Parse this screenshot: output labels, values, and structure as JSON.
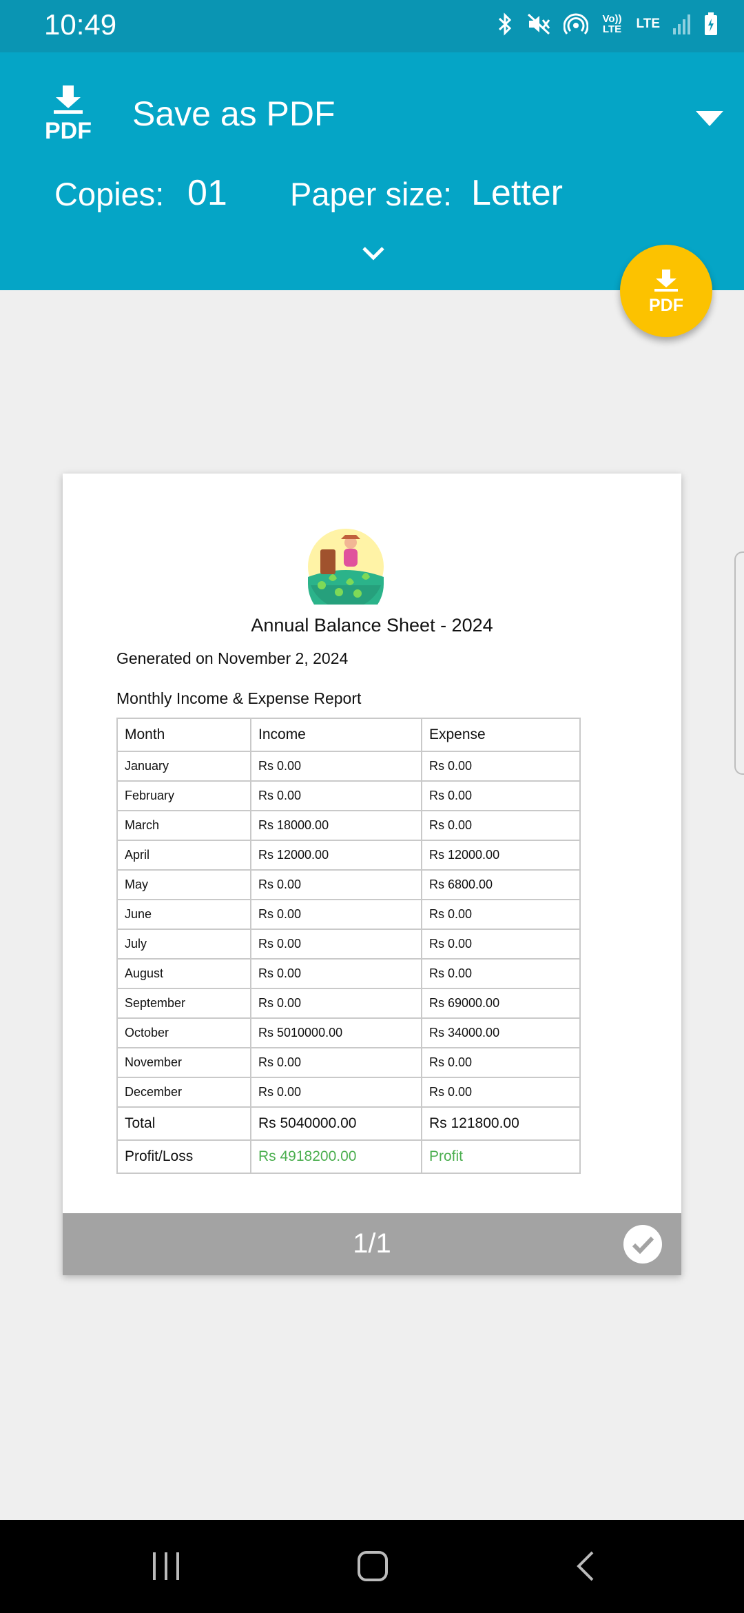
{
  "status": {
    "time": "10:49",
    "lte_label": "LTE",
    "volte_label": "Vo)) LTE"
  },
  "header": {
    "pdf_icon_text": "PDF",
    "title": "Save as PDF",
    "copies_label": "Copies:",
    "copies_value": "01",
    "paper_label": "Paper size:",
    "paper_value": "Letter"
  },
  "fab": {
    "label": "PDF"
  },
  "document": {
    "title": "Annual Balance Sheet - 2024",
    "generated": "Generated on November 2, 2024",
    "subtitle": "Monthly Income & Expense Report",
    "columns": [
      "Month",
      "Income",
      "Expense"
    ],
    "rows": [
      {
        "month": "January",
        "income": "Rs 0.00",
        "expense": "Rs 0.00"
      },
      {
        "month": "February",
        "income": "Rs 0.00",
        "expense": "Rs 0.00"
      },
      {
        "month": "March",
        "income": "Rs 18000.00",
        "expense": "Rs 0.00"
      },
      {
        "month": "April",
        "income": "Rs 12000.00",
        "expense": "Rs 12000.00"
      },
      {
        "month": "May",
        "income": "Rs 0.00",
        "expense": "Rs 6800.00"
      },
      {
        "month": "June",
        "income": "Rs 0.00",
        "expense": "Rs 0.00"
      },
      {
        "month": "July",
        "income": "Rs 0.00",
        "expense": "Rs 0.00"
      },
      {
        "month": "August",
        "income": "Rs 0.00",
        "expense": "Rs 0.00"
      },
      {
        "month": "September",
        "income": "Rs 0.00",
        "expense": "Rs 69000.00"
      },
      {
        "month": "October",
        "income": "Rs 5010000.00",
        "expense": "Rs 34000.00"
      },
      {
        "month": "November",
        "income": "Rs 0.00",
        "expense": "Rs 0.00"
      },
      {
        "month": "December",
        "income": "Rs 0.00",
        "expense": "Rs 0.00"
      }
    ],
    "total": {
      "label": "Total",
      "income": "Rs 5040000.00",
      "expense": "Rs 121800.00"
    },
    "profit": {
      "label": "Profit/Loss",
      "value": "Rs 4918200.00",
      "status": "Profit"
    }
  },
  "page_indicator": "1/1",
  "colors": {
    "header": "#05a5c6",
    "status_bar": "#0a95b3",
    "fab": "#fcc200",
    "profit": "#4caf50"
  }
}
